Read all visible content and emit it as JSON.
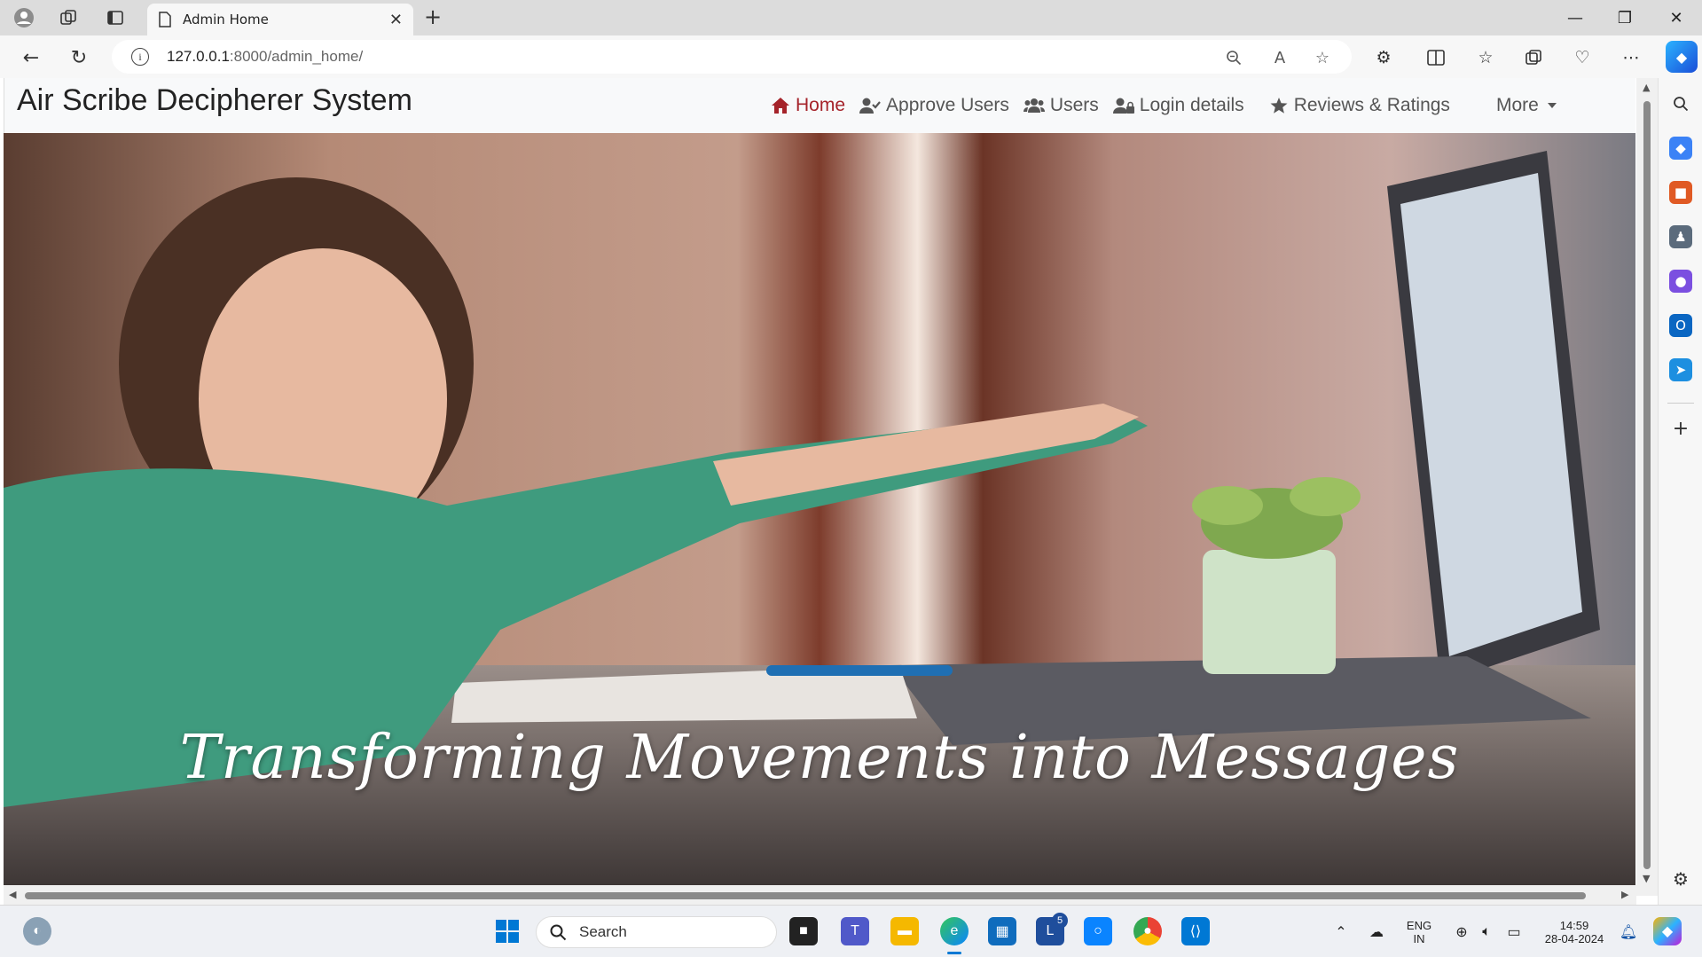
{
  "browser": {
    "tab_title": "Admin Home",
    "url_host": "127.0.0.1",
    "url_path": ":8000/admin_home/"
  },
  "site": {
    "brand": "Air Scribe Decipherer System",
    "menu": [
      {
        "label": "Home",
        "icon": "home-icon",
        "active": true
      },
      {
        "label": "Approve Users",
        "icon": "user-check-icon",
        "active": false
      },
      {
        "label": "Users",
        "icon": "users-icon",
        "active": false
      },
      {
        "label": "Login details",
        "icon": "user-lock-icon",
        "active": false
      },
      {
        "label": "Reviews & Ratings",
        "icon": "star-icon",
        "active": false
      }
    ],
    "more_label": "More",
    "hero_headline": "Transforming Movements into Messages"
  },
  "taskbar": {
    "search_placeholder": "Search",
    "language_top": "ENG",
    "language_bottom": "IN",
    "time": "14:59",
    "date": "28-04-2024",
    "badge_count": "5"
  },
  "colors": {
    "active_nav": "#a5232a",
    "nav_text": "#555555",
    "navbar_bg": "#f8f9fa"
  }
}
